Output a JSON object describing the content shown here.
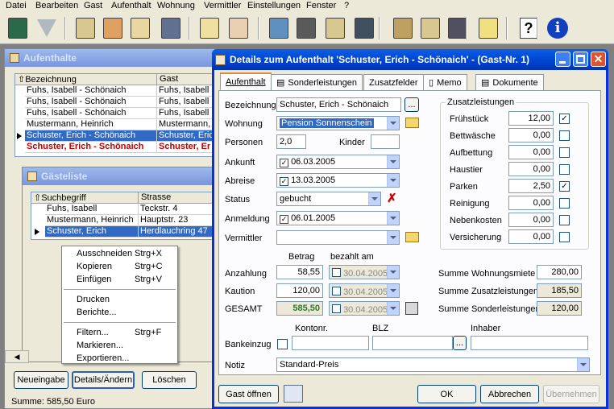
{
  "menu": [
    "Datei",
    "Bearbeiten",
    "Gast",
    "Aufenthalt",
    "Wohnung",
    "Vermittler",
    "Einstellungen",
    "Fenster",
    "?"
  ],
  "toolbar_icons": [
    "exit-icon",
    "filter-icon",
    "guest-card-icon",
    "guests-icon",
    "guest-list-icon",
    "guest-print-icon",
    "money-icon",
    "calendar-mo-icon",
    "book-icon",
    "apartment-icon",
    "building-icon",
    "apartment-print-icon",
    "house-icon",
    "house-list-icon",
    "house-print-icon",
    "cleaning-icon",
    "help-icon",
    "info-icon"
  ],
  "aufenthalte": {
    "title": "Aufenthalte",
    "col_bezeichnung": "Bezeichnung",
    "col_gast": "Gast",
    "rows": [
      {
        "bez": "Fuhs, Isabell - Schönaich",
        "gast": "Fuhs, Isabell"
      },
      {
        "bez": "Fuhs, Isabell - Schönaich",
        "gast": "Fuhs, Isabell"
      },
      {
        "bez": "Fuhs, Isabell - Schönaich",
        "gast": "Fuhs, Isabell"
      },
      {
        "bez": "Mustermann, Heinrich",
        "gast": "Mustermann, H"
      },
      {
        "bez": "Schuster, Erich - Schönaich",
        "gast": "Schuster, Erich"
      },
      {
        "bez": "Schuster, Erich - Schönaich",
        "gast": "Schuster, Er"
      }
    ],
    "btn_neu": "Neueingabe",
    "btn_details": "Details/Ändern",
    "btn_loeschen": "Löschen",
    "summe": "Summe: 585,50 Euro"
  },
  "gaesteliste": {
    "title": "Gästeliste",
    "col_such": "Suchbegriff",
    "col_strasse": "Strasse",
    "rows": [
      {
        "such": "Fuhs, Isabell",
        "str": "Teckstr. 4"
      },
      {
        "such": "Mustermann, Heinrich",
        "str": "Hauptstr. 23"
      },
      {
        "such": "Schuster, Erich",
        "str": "Herdlauchring 47"
      }
    ]
  },
  "context_menu": {
    "ausschneiden": "Ausschneiden",
    "ausschneiden_k": "Strg+X",
    "kopieren": "Kopieren",
    "kopieren_k": "Strg+C",
    "einfuegen": "Einfügen",
    "einfuegen_k": "Strg+V",
    "drucken": "Drucken",
    "berichte": "Berichte...",
    "filtern": "Filtern...",
    "filtern_k": "Strg+F",
    "markieren": "Markieren...",
    "exportieren": "Exportieren..."
  },
  "dialog": {
    "title": "Details zum Aufenthalt 'Schuster, Erich - Schönaich' - (Gast-Nr. 1)",
    "tabs": [
      "Aufenthalt",
      "Sonderleistungen",
      "Zusatzfelder",
      "Memo",
      "Dokumente"
    ],
    "lbl_bezeichnung": "Bezeichnung",
    "bezeichnung": "Schuster, Erich - Schönaich",
    "browse": "...",
    "lbl_wohnung": "Wohnung",
    "wohnung": "Pension Sonnenschein",
    "lbl_personen": "Personen",
    "personen": "2,0",
    "lbl_kinder": "Kinder",
    "kinder": "",
    "lbl_ankunft": "Ankunft",
    "ankunft": "06.03.2005",
    "lbl_abreise": "Abreise",
    "abreise": "13.03.2005",
    "lbl_status": "Status",
    "status": "gebucht",
    "lbl_anmeldung": "Anmeldung",
    "anmeldung": "06.01.2005",
    "lbl_vermittler": "Vermittler",
    "vermittler": "",
    "lbl_betrag": "Betrag",
    "lbl_bezahlt": "bezahlt am",
    "lbl_anzahlung": "Anzahlung",
    "anzahlung": "58,55",
    "anz_datum": "30.04.2005",
    "lbl_kaution": "Kaution",
    "kaution": "120,00",
    "kau_datum": "30.04.2005",
    "lbl_gesamt": "GESAMT",
    "gesamt": "585,50",
    "ges_datum": "30.04.2005",
    "zusatz_title": "Zusatzleistungen",
    "zusatz": [
      {
        "name": "Frühstück",
        "val": "12,00",
        "checked": true
      },
      {
        "name": "Bettwäsche",
        "val": "0,00",
        "checked": false
      },
      {
        "name": "Aufbettung",
        "val": "0,00",
        "checked": false
      },
      {
        "name": "Haustier",
        "val": "0,00",
        "checked": false
      },
      {
        "name": "Parken",
        "val": "2,50",
        "checked": true
      },
      {
        "name": "Reinigung",
        "val": "0,00",
        "checked": false
      },
      {
        "name": "Nebenkosten",
        "val": "0,00",
        "checked": false
      },
      {
        "name": "Versicherung",
        "val": "0,00",
        "checked": false
      }
    ],
    "lbl_summe_wohnung": "Summe Wohnungsmiete",
    "summe_wohnung": "280,00",
    "lbl_summe_zusatz": "Summe Zusatzleistungen",
    "summe_zusatz": "185,50",
    "lbl_summe_sonder": "Summe Sonderleistungen",
    "summe_sonder": "120,00",
    "lbl_kontonr": "Kontonr.",
    "lbl_blz": "BLZ",
    "lbl_inhaber": "Inhaber",
    "lbl_bankeinzug": "Bankeinzug",
    "lbl_notiz": "Notiz",
    "notiz": "Standard-Preis",
    "btn_gast": "Gast öffnen",
    "btn_ok": "OK",
    "btn_abbrechen": "Abbrechen",
    "btn_uebernehmen": "Übernehmen"
  }
}
